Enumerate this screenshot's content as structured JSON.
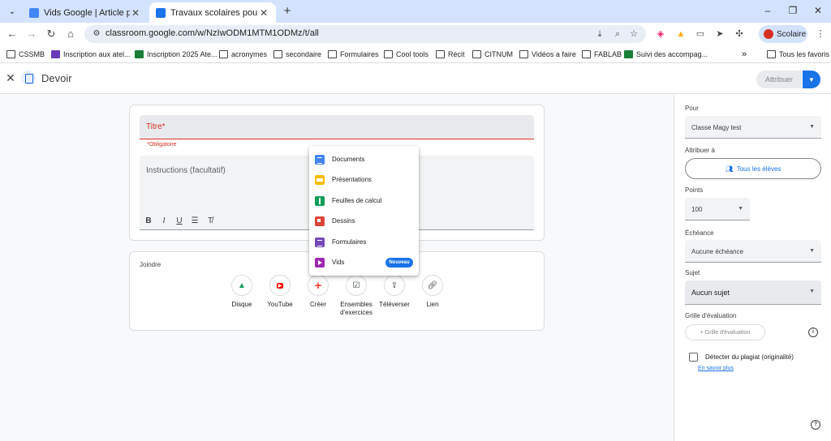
{
  "browser": {
    "tabs": [
      {
        "title": "Vids Google | Article pédagogiqu",
        "close": "✕"
      },
      {
        "title": "Travaux scolaires pour Classe M",
        "close": "✕"
      }
    ],
    "new_tab": "+",
    "url": "classroom.google.com/w/NzIwODM1MTM1ODMz/t/all",
    "profile_label": "Scolaire",
    "bookmarks": [
      "CSSMB",
      "Inscription aux atel...",
      "Inscription 2025 Ate...",
      "acronymes",
      "secondaire",
      "Formulaires",
      "Cool tools",
      "Récit",
      "CITNUM",
      "Vidéos a faire",
      "FABLAB",
      "Suivi des accompag...",
      "Tous les favoris"
    ],
    "bookmarks_more": "»"
  },
  "header": {
    "title": "Devoir",
    "assign_label": "Attribuer"
  },
  "form": {
    "title_placeholder": "Titre*",
    "required_text": "*Obligatoire",
    "instructions_placeholder": "Instructions (facultatif)",
    "format": [
      "B",
      "I",
      "U",
      "☰",
      "T̸"
    ]
  },
  "attach": {
    "label": "Joindre",
    "items": [
      "Disque",
      "YouTube",
      "Créer",
      "Ensembles d'exercices",
      "Téléverser",
      "Lien"
    ]
  },
  "create_menu": {
    "items": [
      "Documents",
      "Présentations",
      "Feuilles de calcul",
      "Dessins",
      "Formulaires",
      "Vids"
    ],
    "new_badge": "Nouveau"
  },
  "side": {
    "for_label": "Pour",
    "class_value": "Classe Magy test",
    "assign_to_label": "Attribuer à",
    "students_button": "Tous les élèves",
    "points_label": "Points",
    "points_value": "100",
    "due_label": "Échéance",
    "due_value": "Aucune échéance",
    "topic_label": "Sujet",
    "topic_value": "Aucun sujet",
    "rubric_label": "Grille d'évaluation",
    "rubric_button": "+ Grille d'évaluation",
    "plagiarism_label": "Détecter du plagiat (originalité)",
    "learn_more": "En savoir plus"
  }
}
